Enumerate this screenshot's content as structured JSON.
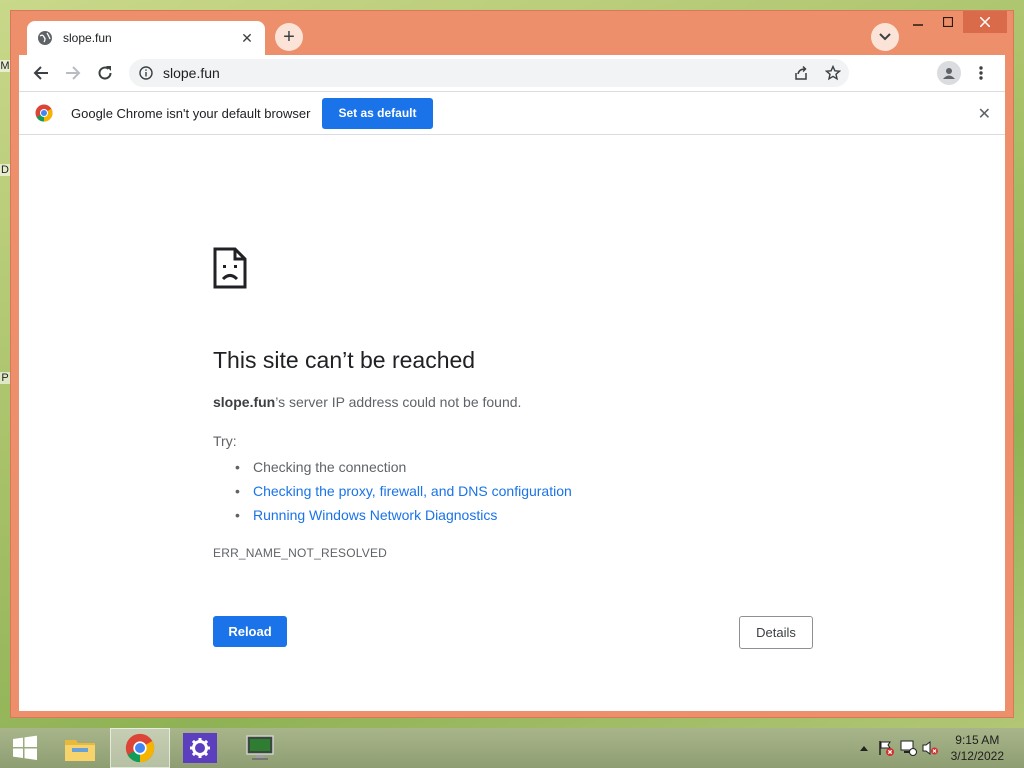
{
  "desktop": {
    "edge_letters": [
      "M",
      "D",
      "P"
    ]
  },
  "tab": {
    "title": "slope.fun",
    "close_glyph": "✕",
    "new_tab_glyph": "+"
  },
  "omnibox": {
    "url": "slope.fun"
  },
  "infobar": {
    "message": "Google Chrome isn't your default browser",
    "button_label": "Set as default",
    "close_glyph": "✕"
  },
  "error_page": {
    "title": "This site can’t be reached",
    "domain": "slope.fun",
    "description_suffix": "’s server IP address could not be found.",
    "try_label": "Try:",
    "suggestions": [
      "Checking the connection",
      "Checking the proxy, firewall, and DNS configuration",
      "Running Windows Network Diagnostics"
    ],
    "error_code": "ERR_NAME_NOT_RESOLVED",
    "reload_label": "Reload",
    "details_label": "Details"
  },
  "taskbar": {
    "time": "9:15 AM",
    "date": "3/12/2022"
  },
  "colors": {
    "accent": "#1a73e8",
    "window_frame": "#ec8f6a",
    "link": "#1a73e8"
  }
}
